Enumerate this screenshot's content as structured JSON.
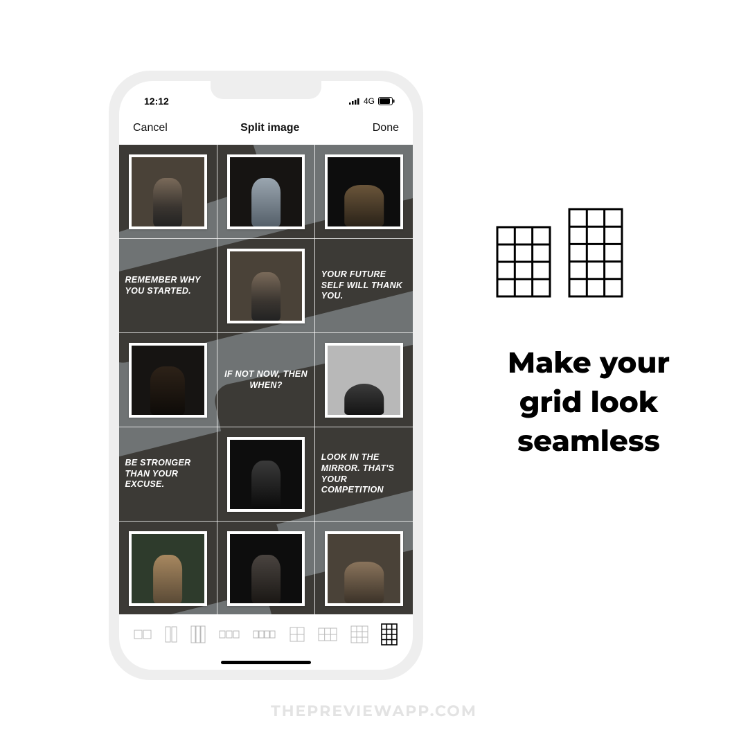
{
  "status": {
    "time": "12:12",
    "network": "4G"
  },
  "nav": {
    "cancel": "Cancel",
    "title": "Split image",
    "done": "Done"
  },
  "quotes": {
    "r2c1": "REMEMBER WHY YOU STARTED.",
    "r2c3": "YOUR FUTURE SELF WILL THANK YOU.",
    "r3c2": "IF NOT NOW, THEN WHEN?",
    "r4c1": "BE STRONGER THAN YOUR EXCUSE.",
    "r4c3": "LOOK IN THE MIRROR. THAT'S YOUR COMPETITION"
  },
  "headline": "Make your grid look seamless",
  "watermark": "THEPREVIEWAPP.COM"
}
